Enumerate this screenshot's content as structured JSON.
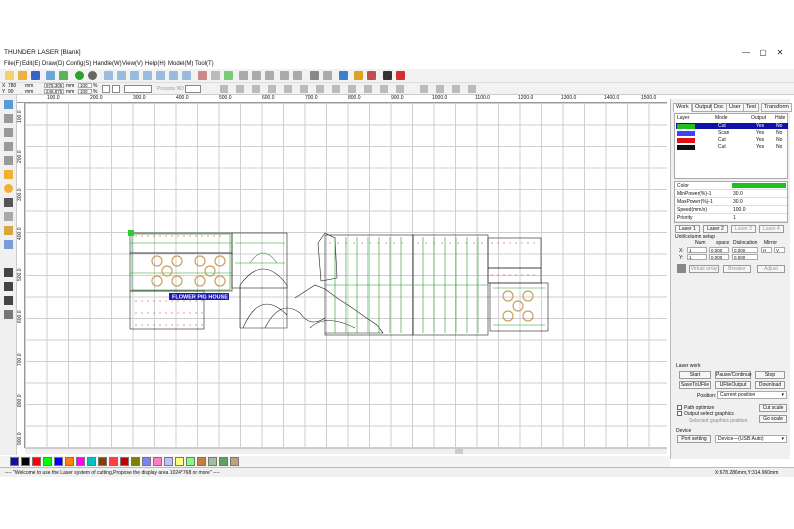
{
  "window": {
    "title": "THUNDER LASER [Blank]",
    "controls": {
      "minimize": "—",
      "maximize": "▢",
      "close": "✕"
    }
  },
  "menu": [
    "File(F)",
    "Edit(E)",
    "Draw(D)",
    "Config(S)",
    "Handle(W)",
    "View(V)",
    "Help(H)",
    "Model(M)",
    "Tool(T)"
  ],
  "coords": {
    "x_label": "X",
    "y_label": "Y",
    "x_value": "780",
    "y_value": "90",
    "w_value": "978.305",
    "h_value": "246.875",
    "unit": "mm",
    "pct": "100",
    "pct_unit": "%"
  },
  "process_no": "Process NO",
  "ruler": {
    "h_ticks": [
      "100.0",
      "200.0",
      "300.0",
      "400.0",
      "500.0",
      "600.0",
      "700.0",
      "800.0",
      "900.0",
      "1000.0",
      "1100.0",
      "1200.0",
      "1300.0",
      "1400.0",
      "1500.0"
    ],
    "v_ticks": [
      "100.0",
      "200.0",
      "300.0",
      "400.0",
      "500.0",
      "600.0",
      "700.0",
      "800.0",
      "900.0"
    ]
  },
  "canvas": {
    "label_text": "FLOWER PIG HOUSE",
    "fill_color": "#ffffff",
    "grid_color": "#cfcfcf",
    "cut_color": "#1e1e1e",
    "scan_color": "#2a9a2a",
    "mark_color": "#d83030"
  },
  "panel": {
    "tabs": [
      "Work",
      "Output",
      "Doc",
      "User",
      "Test",
      "Transform"
    ],
    "layer_headers": [
      "Layer",
      "Mode",
      "Output",
      "Hide"
    ],
    "layers": [
      {
        "color": "#1fbf1f",
        "mode": "Cut",
        "output": "Yes",
        "hide": "No",
        "selected": true
      },
      {
        "color": "#4040ff",
        "mode": "Scan",
        "output": "Yes",
        "hide": "No",
        "selected": false
      },
      {
        "color": "#e01010",
        "mode": "Cut",
        "output": "Yes",
        "hide": "No",
        "selected": false
      },
      {
        "color": "#111111",
        "mode": "Cut",
        "output": "Yes",
        "hide": "No",
        "selected": false
      }
    ],
    "props": [
      {
        "k": "Color",
        "v": ""
      },
      {
        "k": "MinPower(%)-1",
        "v": "30.0"
      },
      {
        "k": "MaxPower(%)-1",
        "v": "30.0"
      },
      {
        "k": "Speed(mm/s)",
        "v": "100.0"
      },
      {
        "k": "Priority",
        "v": "1"
      }
    ],
    "color_value": "#1fbf1f",
    "laser_buttons": [
      "Laser 1",
      "Laser 2",
      "Laser 3",
      "Laser 4"
    ],
    "unit_setup": "Unit/column setup",
    "grid_headers": [
      "Num",
      "space",
      "Dislocation",
      "Mirror"
    ],
    "x_row": {
      "label": "X:",
      "num": "1",
      "space": "0.000",
      "disl": "0.000",
      "m1": "H",
      "m2": "V"
    },
    "y_row": {
      "label": "Y:",
      "num": "1",
      "space": "0.000",
      "disl": "0.000"
    },
    "array_buttons": [
      "Virtual array",
      "Breaker",
      "Adjust"
    ],
    "laser_work": "Laser work",
    "work_buttons": [
      "Start",
      "Pause/Continue",
      "Stop",
      "SaveToUFile",
      "UFileOutput",
      "Download"
    ],
    "position_label": "Position:",
    "position_value": "Current position",
    "path_optimize": "Path optimize",
    "output_select": "Output select graphics",
    "selected_pos": "Selected graphics position",
    "cut_scale": "Cut scale",
    "go_scale": "Go scale",
    "device": "Device",
    "port_setting": "Port setting",
    "device_value": "Device—(USB:Auto)"
  },
  "palette": [
    "#1010a0",
    "#000000",
    "#ff0000",
    "#00ff00",
    "#0000ff",
    "#ff8000",
    "#ff00ff",
    "#00c0c0",
    "#804000",
    "#ff4040",
    "#c00000",
    "#808000",
    "#8080ff",
    "#ff80c0",
    "#c0c0ff",
    "#ffff80",
    "#80ff80",
    "#c08040",
    "#a0c0a0",
    "#60a060",
    "#c0a080"
  ],
  "status": {
    "message": "---- \"Welcome to use the Laser system of cutting,Propose the display area 1024*768 or more\" ----",
    "position": "X:678.286mm,Y:314.960mm"
  }
}
